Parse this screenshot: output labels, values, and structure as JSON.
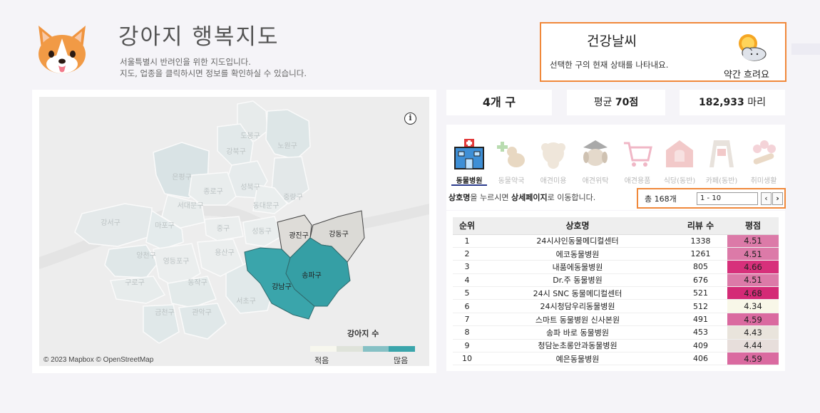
{
  "header": {
    "title": "강아지 행복지도",
    "subtitle_line1": "서울특별시 반려인을 위한 지도입니다.",
    "subtitle_line2": "지도, 업종을 클릭하시면 정보를 확인하실 수 있습니다."
  },
  "weather": {
    "title": "건강날씨",
    "description": "선택한 구의 현재 상태를 나타내요.",
    "status": "약간 흐려요",
    "icon": "sun-cloud-icon"
  },
  "map": {
    "info_symbol": "i",
    "attribution": "© 2023 Mapbox © OpenStreetMap",
    "legend_title": "강아지 수",
    "legend_low": "적음",
    "legend_high": "많음",
    "legend_colors": [
      "#f7f7ee",
      "#dfe3da",
      "#86c1c5",
      "#3aa5ab"
    ],
    "districts": {
      "dobong": "도봉구",
      "nowon": "노원구",
      "gangbuk": "강북구",
      "eunpyeong": "은평구",
      "seongbuk": "성북구",
      "jongno": "종로구",
      "jungnang": "중랑구",
      "dongdaemun": "동대문구",
      "seodaemun": "서대문구",
      "gangseo": "강서구",
      "mapo": "마포구",
      "jung": "중구",
      "seongdong": "성동구",
      "gwangjin": "광진구",
      "gangdong": "강동구",
      "yangcheon": "양천구",
      "yongsan": "용산구",
      "yeongdeungpo": "영등포구",
      "songpa": "송파구",
      "guro": "구로구",
      "dongjak": "동작구",
      "gangnam": "강남구",
      "seocho": "서초구",
      "geumcheon": "금천구",
      "gwanak": "관악구"
    }
  },
  "kpis": {
    "districts_count": "4개 구",
    "avg_prefix": "평균",
    "avg_value": "70점",
    "dogs_value": "182,933",
    "dogs_unit": "마리"
  },
  "categories": [
    {
      "label": "동물병원",
      "icon": "hospital-icon",
      "active": true
    },
    {
      "label": "동물약국",
      "icon": "pharmacy-icon",
      "active": false
    },
    {
      "label": "애견미용",
      "icon": "grooming-icon",
      "active": false
    },
    {
      "label": "애견위탁",
      "icon": "boarding-icon",
      "active": false
    },
    {
      "label": "애견용품",
      "icon": "cart-icon",
      "active": false
    },
    {
      "label": "식당(동반)",
      "icon": "restaurant-icon",
      "active": false
    },
    {
      "label": "카페(동반)",
      "icon": "cafe-icon",
      "active": false
    },
    {
      "label": "취미생활",
      "icon": "hobby-icon",
      "active": false
    }
  ],
  "hint": {
    "part1": "상호명",
    "part2": "을 누르시면 ",
    "part3": "상세페이지",
    "part4": "로 이동합니다."
  },
  "pager": {
    "total": "총 168개",
    "range": "1 - 10",
    "prev": "‹",
    "next": "›"
  },
  "table": {
    "headers": {
      "rank": "순위",
      "name": "상호명",
      "reviews": "리뷰 수",
      "rating": "평점"
    },
    "rows": [
      {
        "rank": "1",
        "name": "24시샤인동물메디컬센터",
        "reviews": "1338",
        "rating": "4.51",
        "color": "#dc7aa8"
      },
      {
        "rank": "2",
        "name": "에코동물병원",
        "reviews": "1261",
        "rating": "4.51",
        "color": "#dc7aa8"
      },
      {
        "rank": "3",
        "name": "내품에동물병원",
        "reviews": "805",
        "rating": "4.66",
        "color": "#d7307b"
      },
      {
        "rank": "4",
        "name": "Dr.주 동물병원",
        "reviews": "676",
        "rating": "4.51",
        "color": "#dc7aa8"
      },
      {
        "rank": "5",
        "name": "24시 SNC 동물메디컬센터",
        "reviews": "521",
        "rating": "4.68",
        "color": "#d42a76"
      },
      {
        "rank": "6",
        "name": "24시청담우리동물병원",
        "reviews": "512",
        "rating": "4.34",
        "color": "#f8f7e8"
      },
      {
        "rank": "7",
        "name": "스마트 동물병원 신사본원",
        "reviews": "491",
        "rating": "4.59",
        "color": "#da6aa0"
      },
      {
        "rank": "8",
        "name": "송파 바로 동물병원",
        "reviews": "453",
        "rating": "4.43",
        "color": "#e9e4dc"
      },
      {
        "rank": "9",
        "name": "청담눈초롱안과동물병원",
        "reviews": "409",
        "rating": "4.44",
        "color": "#e7dedb"
      },
      {
        "rank": "10",
        "name": "예은동물병원",
        "reviews": "406",
        "rating": "4.59",
        "color": "#da6aa0"
      }
    ]
  }
}
